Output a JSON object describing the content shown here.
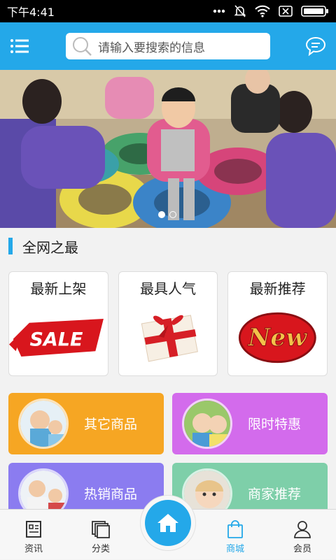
{
  "status_bar": {
    "time": "下午4:41"
  },
  "header": {
    "search_placeholder": "请输入要搜索的信息",
    "menu_icon": "menu-icon",
    "message_icon": "chat-icon"
  },
  "banner": {
    "slide_count": 2,
    "active_index": 0
  },
  "section": {
    "title": "全网之最"
  },
  "cards": [
    {
      "label": "最新上架",
      "art": "SALE"
    },
    {
      "label": "最具人气",
      "art": "gift"
    },
    {
      "label": "最新推荐",
      "art": "New"
    }
  ],
  "tiles": [
    {
      "label": "其它商品",
      "color": "#f6a623"
    },
    {
      "label": "限时特惠",
      "color": "#d36bec"
    },
    {
      "label": "热销商品",
      "color": "#8b7cf0"
    },
    {
      "label": "商家推荐",
      "color": "#7ecfa9"
    }
  ],
  "tabbar": {
    "items": [
      {
        "label": "资讯",
        "icon": "news-icon"
      },
      {
        "label": "分类",
        "icon": "category-icon"
      },
      {
        "label": "商城",
        "icon": "shopping-bag-icon",
        "active": true
      },
      {
        "label": "会员",
        "icon": "user-icon"
      }
    ],
    "home_icon": "home-icon"
  },
  "colors": {
    "accent": "#24a8e9"
  }
}
